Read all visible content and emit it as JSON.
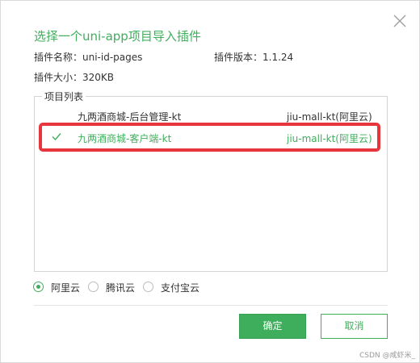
{
  "dialog": {
    "title": "选择一个uni-app项目导入插件",
    "info": {
      "plugin_name": "插件名称：uni-id-pages",
      "plugin_version": "插件版本：1.1.24",
      "plugin_size": "插件大小：320KB"
    },
    "project_list": {
      "legend": "项目列表",
      "items": [
        {
          "name": "九两酒商城-后台管理-kt",
          "source": "jiu-mall-kt(阿里云)",
          "selected": false
        },
        {
          "name": "九两酒商城-客户端-kt",
          "source": "jiu-mall-kt(阿里云)",
          "selected": true
        }
      ]
    },
    "cloud_options": [
      {
        "label": "阿里云",
        "checked": true
      },
      {
        "label": "腾讯云",
        "checked": false
      },
      {
        "label": "支付宝云",
        "checked": false
      }
    ],
    "buttons": {
      "ok": "确定",
      "cancel": "取消"
    },
    "watermark": "CSDN @咸虾米_"
  },
  "colors": {
    "accent": "#3fae5c",
    "highlight_border": "#e8363d"
  },
  "icons": {
    "close": "close-icon",
    "check": "check-icon"
  }
}
